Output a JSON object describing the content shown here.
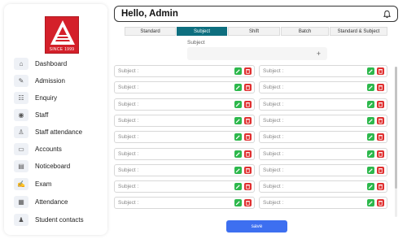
{
  "logo": {
    "tagline": "SINCE 1999",
    "color": "#d4202a"
  },
  "sidebar": {
    "items": [
      {
        "label": "Dashboard",
        "icon": "home-icon"
      },
      {
        "label": "Admission",
        "icon": "admission-icon"
      },
      {
        "label": "Enquiry",
        "icon": "enquiry-icon"
      },
      {
        "label": "Staff",
        "icon": "staff-icon"
      },
      {
        "label": "Staff attendance",
        "icon": "staff-attendance-icon"
      },
      {
        "label": "Accounts",
        "icon": "accounts-icon"
      },
      {
        "label": "Noticeboard",
        "icon": "noticeboard-icon"
      },
      {
        "label": "Exam",
        "icon": "exam-icon"
      },
      {
        "label": "Attendance",
        "icon": "attendance-icon"
      },
      {
        "label": "Student contacts",
        "icon": "contacts-icon"
      }
    ]
  },
  "header": {
    "title": "Hello, Admin",
    "bell_icon": "bell-icon"
  },
  "tabs": [
    {
      "label": "Standard",
      "active": false
    },
    {
      "label": "Subject",
      "active": true
    },
    {
      "label": "Shift",
      "active": false
    },
    {
      "label": "Batch",
      "active": false
    },
    {
      "label": "Standard & Subject",
      "active": false
    }
  ],
  "subject_form": {
    "label": "Subject",
    "add_symbol": "+"
  },
  "rows": {
    "left": [
      "Subject :",
      "Subject :",
      "Subject :",
      "Subject :",
      "Subject :",
      "Subject :",
      "Subject :",
      "Subject :",
      "Subject :"
    ],
    "right": [
      "Subject :",
      "Subject :",
      "Subject :",
      "Subject :",
      "Subject :",
      "Subject :",
      "Subject :",
      "Subject :",
      "Subject :"
    ]
  },
  "save": {
    "label": "save"
  },
  "colors": {
    "accent": "#0e6f7f",
    "save": "#3d6ff0",
    "edit": "#2db84c",
    "delete": "#e02f2f"
  }
}
